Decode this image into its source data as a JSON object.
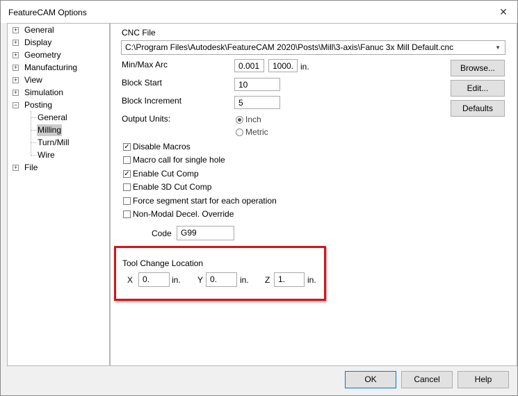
{
  "window": {
    "title": "FeatureCAM Options",
    "close_glyph": "✕"
  },
  "tree": {
    "items": [
      {
        "label": "General",
        "expander": "+"
      },
      {
        "label": "Display",
        "expander": "+"
      },
      {
        "label": "Geometry",
        "expander": "+"
      },
      {
        "label": "Manufacturing",
        "expander": "+"
      },
      {
        "label": "View",
        "expander": "+"
      },
      {
        "label": "Simulation",
        "expander": "+"
      },
      {
        "label": "Posting",
        "expander": "−"
      },
      {
        "label": "General"
      },
      {
        "label": "Milling",
        "selected": true
      },
      {
        "label": "Turn/Mill"
      },
      {
        "label": "Wire"
      },
      {
        "label": "File",
        "expander": "+"
      }
    ]
  },
  "panel": {
    "cnc_file_label": "CNC File",
    "cnc_file_value": "C:\\Program Files\\Autodesk\\FeatureCAM 2020\\Posts\\Mill\\3-axis\\Fanuc 3x Mill Default.cnc",
    "combo_arrow": "▼",
    "minmax_arc_label": "Min/Max Arc",
    "min_arc": "0.001",
    "max_arc": "1000.",
    "arc_unit": "in.",
    "block_start_label": "Block Start",
    "block_start": "10",
    "block_increment_label": "Block Increment",
    "block_increment": "5",
    "output_units_label": "Output Units:",
    "units_inch": "Inch",
    "units_metric": "Metric",
    "selected_unit": "Inch",
    "checkboxes": [
      {
        "label": "Disable Macros",
        "checked": true
      },
      {
        "label": "Macro call for single hole",
        "checked": false
      },
      {
        "label": "Enable Cut Comp",
        "checked": true
      },
      {
        "label": "Enable 3D Cut Comp",
        "checked": false
      },
      {
        "label": "Force segment start for each operation",
        "checked": false
      },
      {
        "label": "Non-Modal Decel. Override",
        "checked": false
      }
    ],
    "check_glyph": "✓",
    "code_label": "Code",
    "code_value": "G99",
    "tool_change": {
      "title": "Tool Change Location",
      "x_label": "X",
      "x_value": "0.",
      "x_unit": "in.",
      "y_label": "Y",
      "y_value": "0.",
      "y_unit": "in.",
      "z_label": "Z",
      "z_value": "1.",
      "z_unit": "in."
    },
    "browse_label": "Browse...",
    "edit_label": "Edit...",
    "defaults_label": "Defaults"
  },
  "footer": {
    "ok": "OK",
    "cancel": "Cancel",
    "help": "Help"
  },
  "colors": {
    "highlight_box": "#d0161a",
    "selection": "#cccccc",
    "default_button_border": "#0078d7"
  }
}
